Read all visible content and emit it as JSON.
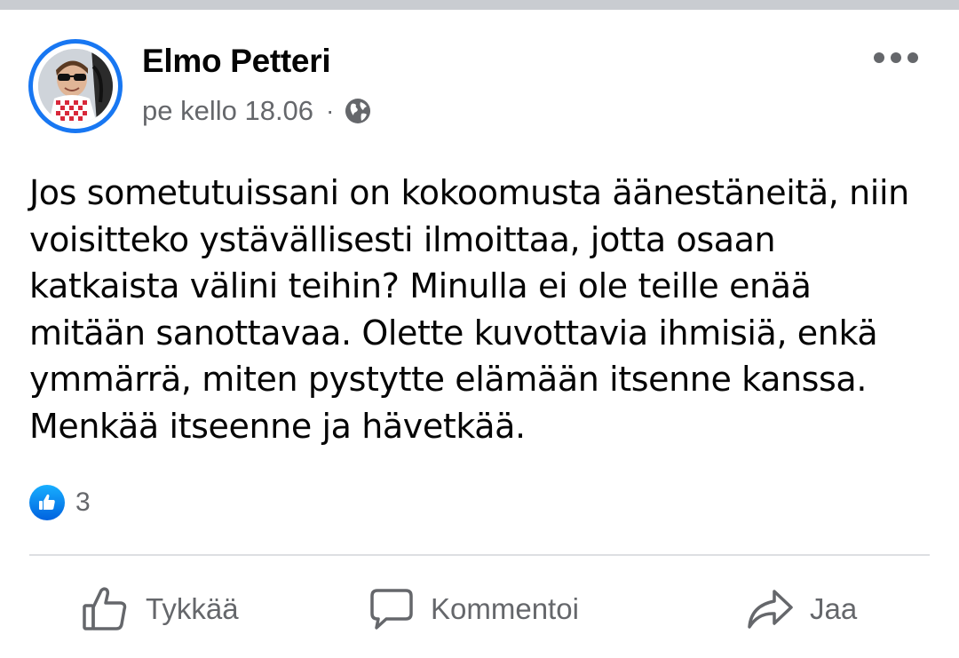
{
  "post": {
    "author": "Elmo Petteri",
    "timestamp": "pe kello 18.06",
    "separator": "·",
    "privacy_icon": "globe-icon",
    "more_icon": "more-options-icon",
    "text": "Jos sometutuissani on kokoomusta äänestäneitä, niin voisitteko ystävällisesti ilmoittaa, jotta osaan katkaista välini teihin? Minulla ei ole teille enää mitään sanottavaa. Olette kuvottavia ihmisiä, enkä ymmärrä, miten pystytte elämään itsenne kanssa. Menkää itseenne ja hävetkää.",
    "reactions": {
      "icon": "like-reaction-icon",
      "count": "3"
    }
  },
  "actions": {
    "like_label": "Tykkää",
    "comment_label": "Kommentoi",
    "share_label": "Jaa"
  },
  "colors": {
    "accent": "#1877f2",
    "secondary_text": "#65676b",
    "primary_text": "#050505",
    "divider": "#dddfe2"
  }
}
